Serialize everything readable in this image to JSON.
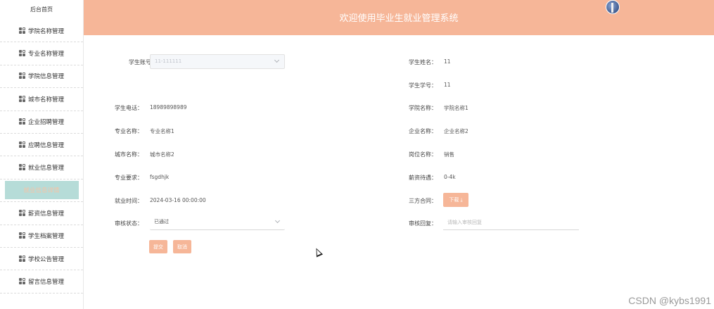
{
  "sidebar": {
    "home": "后台首页",
    "items": [
      {
        "label": "学院名称管理"
      },
      {
        "label": "专业名称管理"
      },
      {
        "label": "学院信息管理"
      },
      {
        "label": "城市名称管理"
      },
      {
        "label": "企业招聘管理"
      },
      {
        "label": "应聘信息管理"
      },
      {
        "label": "就业信息管理"
      },
      {
        "label": "就业信息详情"
      },
      {
        "label": "薪资信息管理"
      },
      {
        "label": "学生档案管理"
      },
      {
        "label": "学校公告管理"
      },
      {
        "label": "留言信息管理"
      }
    ]
  },
  "header": {
    "title": "欢迎使用毕业生就业管理系统"
  },
  "form": {
    "student_account": {
      "label": "学生账号：",
      "value": "11-111111"
    },
    "student_name": {
      "label": "学生姓名：",
      "value": "11"
    },
    "student_no": {
      "label": "学生学号：",
      "value": "11"
    },
    "student_phone": {
      "label": "学生电话：",
      "value": "18989898989"
    },
    "college_name": {
      "label": "学院名称：",
      "value": "学院名称1"
    },
    "major_name": {
      "label": "专业名称：",
      "value": "专业名称1"
    },
    "company_name": {
      "label": "企业名称：",
      "value": "企业名称2"
    },
    "city_name": {
      "label": "城市名称：",
      "value": "城市名称2"
    },
    "position_name": {
      "label": "岗位名称：",
      "value": "销售"
    },
    "major_req": {
      "label": "专业要求：",
      "value": "fsgdhjk"
    },
    "salary": {
      "label": "薪资待遇：",
      "value": "0-4k"
    },
    "employ_time": {
      "label": "就业时间：",
      "value": "2024-03-16 00:00:00"
    },
    "contract": {
      "label": "三方合同：",
      "button": "下载 ⤓"
    },
    "review_status": {
      "label": "审核状态：",
      "value": "已通过"
    },
    "review_reply": {
      "label": "审核回复：",
      "placeholder": "请输入审核回复"
    },
    "submit": "提交",
    "cancel": "取消"
  },
  "watermark": "CSDN @kybs1991",
  "colors": {
    "accent": "#f6b698",
    "active_bg": "#b6dcd8"
  }
}
